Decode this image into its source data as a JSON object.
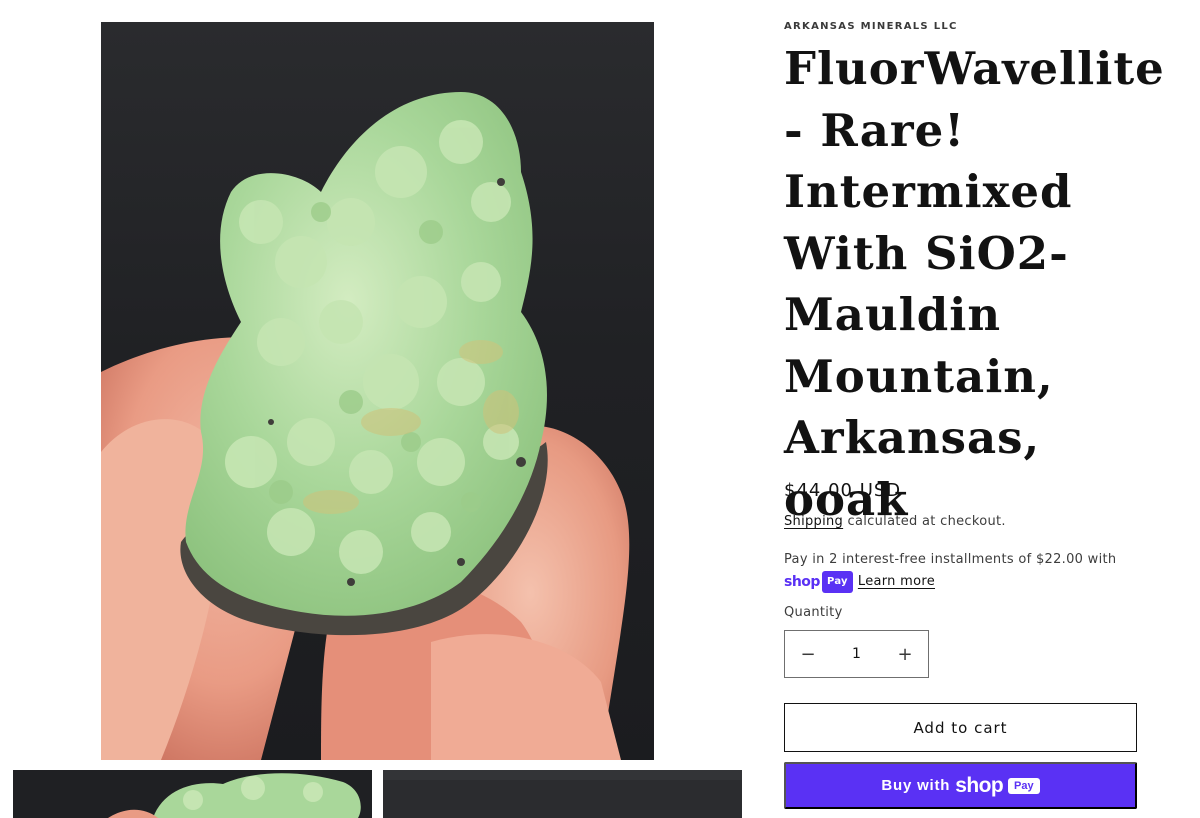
{
  "gallery": {
    "main_image_alt": "FluorWavellite specimen held between fingers",
    "thumbnails": [
      {
        "alt": "FluorWavellite specimen thumbnail 1"
      },
      {
        "alt": "FluorWavellite specimen thumbnail 2"
      }
    ]
  },
  "product": {
    "vendor": "ARKANSAS MINERALS LLC",
    "title_lines": [
      "FluorWavellite",
      "- Rare!",
      "Intermixed",
      "With SiO2-",
      "Mauldin",
      "Mountain,",
      "Arkansas, ooak"
    ],
    "price": "$44.00 USD",
    "shipping_link": "Shipping",
    "shipping_rest": " calculated at checkout.",
    "installments_text": "Pay in 2 interest-free installments of $22.00 with",
    "shoppay_shop": "shop",
    "shoppay_pay": "Pay",
    "learn_more": "Learn more",
    "quantity_label": "Quantity",
    "quantity_value": "1",
    "qty_minus": "−",
    "qty_plus": "+",
    "add_to_cart": "Add to cart",
    "buy_with": "Buy with",
    "buy_shop": "shop",
    "buy_pay": "Pay"
  },
  "colors": {
    "accent_shoppay": "#5a31f4",
    "text": "#121212",
    "specimen_green": "#a9d79a"
  }
}
